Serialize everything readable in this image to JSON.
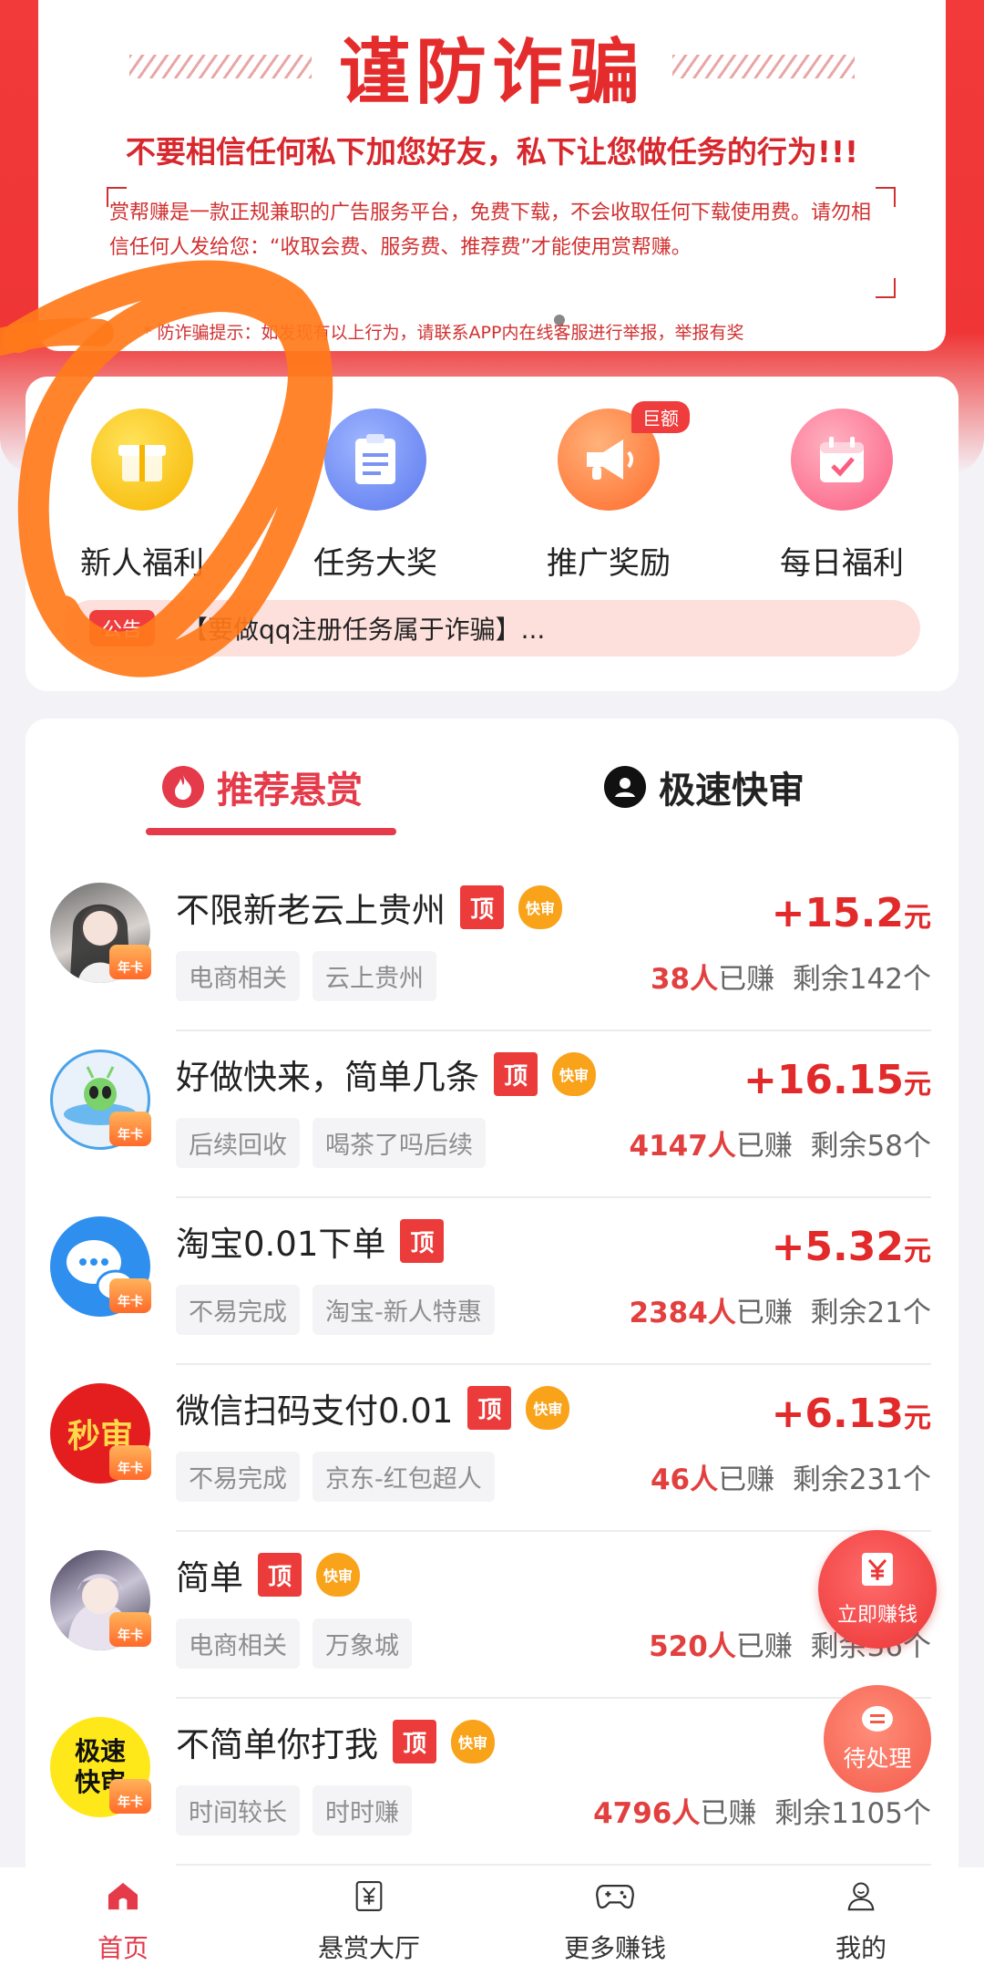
{
  "warning": {
    "title": "谨防诈骗",
    "subtitle": "不要相信任何私下加您好友，私下让您做任务的行为!!!",
    "body": "赏帮赚是一款正规兼职的广告服务平台，免费下载，不会收取任何下载使用费。请勿相信任何人发给您：“收取会费、服务费、推荐费”才能使用赏帮赚。",
    "tip": "* 防诈骗提示：如发现有以上行为，请联系APP内在线客服进行举报，举报有奖"
  },
  "entries": [
    {
      "label": "新人福利",
      "icon": "gift-box-icon"
    },
    {
      "label": "任务大奖",
      "icon": "clipboard-icon"
    },
    {
      "label": "推广奖励",
      "icon": "megaphone-icon",
      "badge": "巨额"
    },
    {
      "label": "每日福利",
      "icon": "calendar-check-icon"
    }
  ],
  "notice": {
    "tag": "公告",
    "text": "【要做qq注册任务属于诈骗】..."
  },
  "tabs": [
    {
      "label": "推荐悬赏",
      "icon": "flame-icon",
      "active": true
    },
    {
      "label": "极速快审",
      "icon": "user-circle-icon",
      "active": false
    }
  ],
  "tasks": [
    {
      "title": "不限新老云上贵州",
      "top": "顶",
      "fast": "快审",
      "tags": [
        "电商相关",
        "云上贵州"
      ],
      "price": "+15.2",
      "unit": "元",
      "earned": "38人",
      "earned_suffix": "已赚",
      "remaining": "剩余142个",
      "avatar": "girl-portrait-avatar",
      "card": "年卡"
    },
    {
      "title": "好做快来，简单几条",
      "top": "顶",
      "fast": "快审",
      "tags": [
        "后续回收",
        "喝茶了吗后续"
      ],
      "price": "+16.15",
      "unit": "元",
      "earned": "4147人",
      "earned_suffix": "已赚",
      "remaining": "剩余58个",
      "avatar": "alien-ufo-avatar",
      "card": "年卡"
    },
    {
      "title": "淘宝0.01下单",
      "top": "顶",
      "fast": "",
      "tags": [
        "不易完成",
        "淘宝-新人特惠"
      ],
      "price": "+5.32",
      "unit": "元",
      "earned": "2384人",
      "earned_suffix": "已赚",
      "remaining": "剩余21个",
      "avatar": "chat-bubble-avatar",
      "card": "年卡"
    },
    {
      "title": "微信扫码支付0.01",
      "top": "顶",
      "fast": "快审",
      "tags": [
        "不易完成",
        "京东-红包超人"
      ],
      "price": "+6.13",
      "unit": "元",
      "earned": "46人",
      "earned_suffix": "已赚",
      "remaining": "剩余231个",
      "avatar": "miaoshen-avatar",
      "avatar_text": "秒审",
      "card": "年卡"
    },
    {
      "title": "简单",
      "top": "顶",
      "fast": "快审",
      "tags": [
        "电商相关",
        "万象城"
      ],
      "price": "",
      "unit": "",
      "earned": "520人",
      "earned_suffix": "已赚",
      "remaining": "剩余36个",
      "avatar": "anime-girl-avatar",
      "card": "年卡"
    },
    {
      "title": "不简单你打我",
      "top": "顶",
      "fast": "快审",
      "tags": [
        "时间较长",
        "时时赚"
      ],
      "price": "",
      "unit": "",
      "earned": "4796人",
      "earned_suffix": "已赚",
      "remaining": "剩余1105个",
      "avatar": "jisu-kuaishen-avatar",
      "avatar_text": "极速快审",
      "card": "年卡"
    }
  ],
  "fab": {
    "earn": "立即赚钱",
    "pending": "待处理"
  },
  "nav": [
    {
      "label": "首页",
      "icon": "home-icon",
      "active": true
    },
    {
      "label": "悬赏大厅",
      "icon": "yuan-doc-icon",
      "active": false
    },
    {
      "label": "更多赚钱",
      "icon": "gamepad-icon",
      "active": false
    },
    {
      "label": "我的",
      "icon": "user-icon",
      "active": false
    }
  ],
  "colors": {
    "brand_red": "#ef3535",
    "price_red": "#e22a2a",
    "tab_active": "#e53a4a",
    "annotation_orange": "#ff7a1a"
  }
}
